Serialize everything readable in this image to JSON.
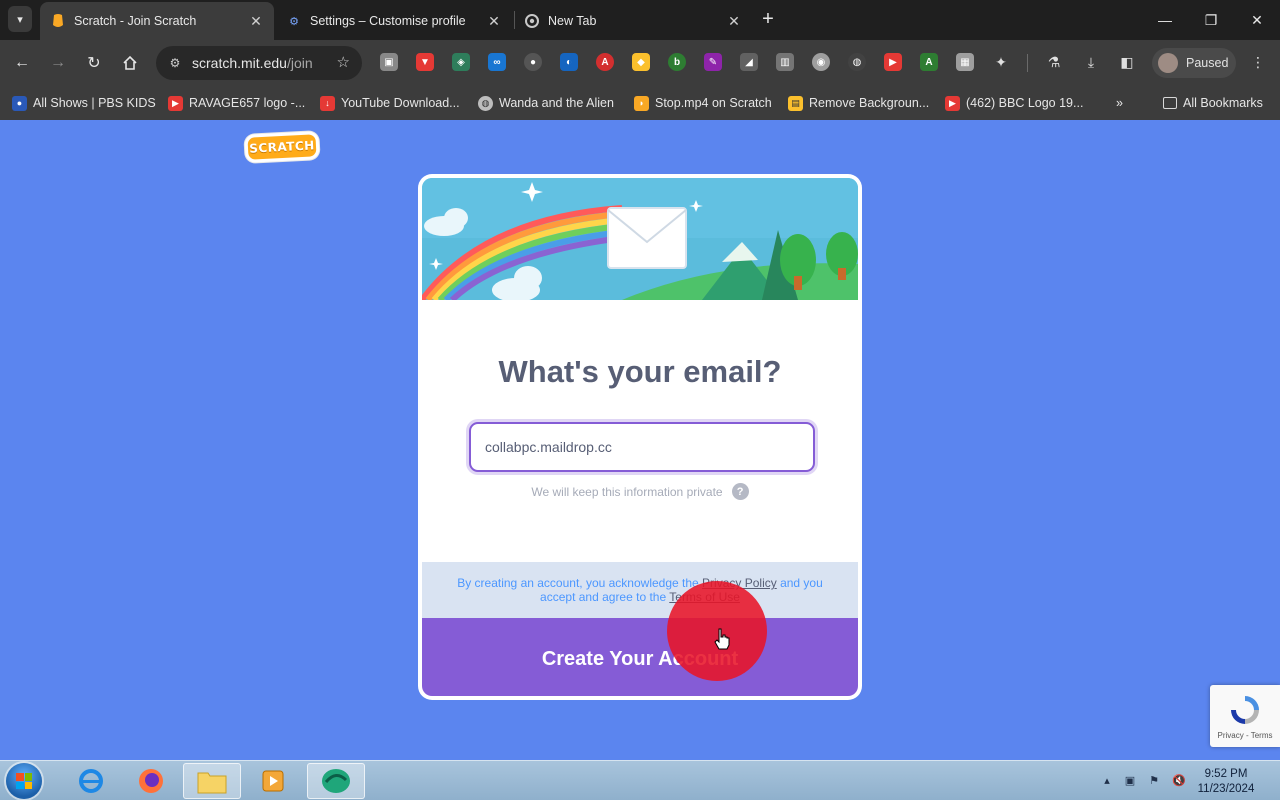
{
  "browser": {
    "tabs": [
      {
        "title": "Scratch - Join Scratch",
        "active": true
      },
      {
        "title": "Settings – Customise profile",
        "active": false
      },
      {
        "title": "New Tab",
        "active": false
      }
    ],
    "address": {
      "domain": "scratch.mit.edu",
      "path": "/join"
    },
    "profile_label": "Paused",
    "bookmarks": [
      "All Shows | PBS KIDS",
      "RAVAGE657 logo -...",
      "YouTube Download...",
      "Wanda and the Alien",
      "Stop.mp4 on Scratch",
      "Remove Backgroun...",
      "(462) BBC Logo 19...",
      "All Bookmarks"
    ]
  },
  "page": {
    "logo_text": "SCRATCH",
    "heading": "What's your email?",
    "email_value": "collabpc.maildrop.cc",
    "privacy_note": "We will keep this information private",
    "help_symbol": "?",
    "terms": {
      "prefix": "By creating an account, you acknowledge the",
      "privacy_link": "Privacy Policy",
      "middle": "and you accept and agree to the",
      "terms_link": "Terms of Use"
    },
    "create_button": "Create Your Account",
    "recaptcha_text": "Privacy - Terms"
  },
  "taskbar": {
    "time": "9:52 PM",
    "date": "11/23/2024"
  },
  "colors": {
    "page_bg": "#5b85ef",
    "scratch_purple": "#855cd6",
    "heading_text": "#575e75",
    "click_indicator": "#e81428"
  }
}
